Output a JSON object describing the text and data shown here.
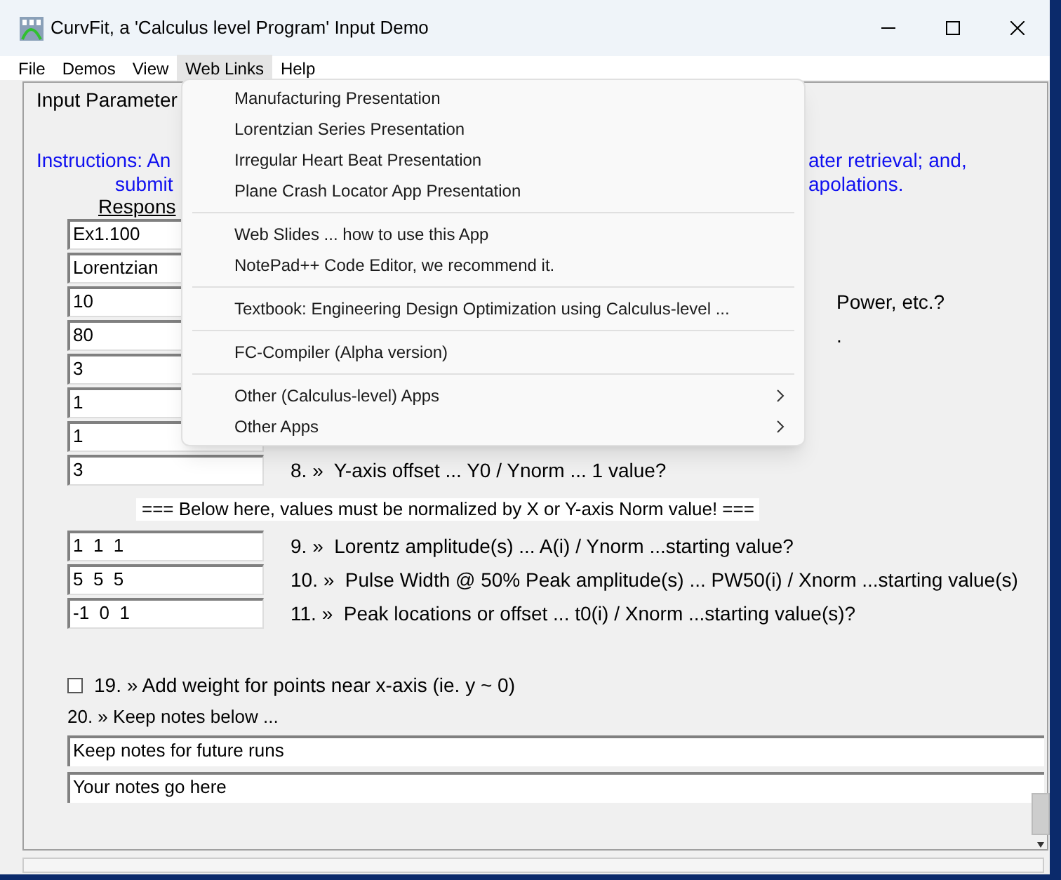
{
  "window": {
    "title": "CurvFit, a 'Calculus level Program' Input Demo"
  },
  "menu_bar": [
    {
      "label": "File",
      "selected": false
    },
    {
      "label": "Demos",
      "selected": false
    },
    {
      "label": "View",
      "selected": false
    },
    {
      "label": "Web Links",
      "selected": true
    },
    {
      "label": "Help",
      "selected": false
    }
  ],
  "web_links_menu": {
    "groups": [
      [
        {
          "label": "Manufacturing Presentation",
          "submenu": false
        },
        {
          "label": "Lorentzian Series Presentation",
          "submenu": false
        },
        {
          "label": "Irregular Heart Beat Presentation",
          "submenu": false
        },
        {
          "label": "Plane Crash Locator App Presentation",
          "submenu": false
        }
      ],
      [
        {
          "label": "Web Slides ... how to use this App",
          "submenu": false
        },
        {
          "label": "NotePad++ Code Editor, we recommend it.",
          "submenu": false
        }
      ],
      [
        {
          "label": "Textbook: Engineering Design Optimization using Calculus-level ...",
          "submenu": false
        }
      ],
      [
        {
          "label": "FC-Compiler (Alpha version)",
          "submenu": false
        }
      ],
      [
        {
          "label": "Other (Calculus-level) Apps",
          "submenu": true
        },
        {
          "label": "Other Apps",
          "submenu": true
        }
      ]
    ]
  },
  "panel": {
    "heading": "Input Parameter",
    "instructions": [
      {
        "left": "Instructions: An",
        "right": "ater retrieval; and,"
      },
      {
        "left": "submit",
        "right": "apolations."
      }
    ],
    "response_heading": "Respons",
    "rows": [
      {
        "value": "Ex1.100"
      },
      {
        "value": "Lorentzian"
      },
      {
        "value": "10",
        "fragment": "Power, etc.?"
      },
      {
        "value": "80",
        "fragment": "."
      },
      {
        "value": "3"
      },
      {
        "value": "1"
      },
      {
        "value": "1"
      },
      {
        "value": "3",
        "question": "8. »  Y-axis offset ... Y0 / Ynorm ... 1 value?"
      }
    ],
    "note": "=== Below here, values must be normalized by X or Y-axis Norm value! ===",
    "rows_normalized": [
      {
        "value": "1  1  1",
        "question": "9. »  Lorentz amplitude(s) ... A(i) / Ynorm ...starting value?"
      },
      {
        "value": "5  5  5",
        "question": "10. »  Pulse Width @ 50% Peak amplitude(s) ... PW50(i) / Xnorm ...starting value(s)"
      },
      {
        "value": "-1  0  1",
        "question": "11. »  Peak locations or offset ... t0(i) / Xnorm ...starting value(s)?"
      }
    ],
    "weight_option": {
      "label": "19. » Add weight for points near x-axis (ie. y ~ 0)",
      "checked": false
    },
    "notes_label": "20. » Keep notes below ...",
    "notes": [
      "Keep notes for future runs",
      "Your notes go here"
    ]
  }
}
